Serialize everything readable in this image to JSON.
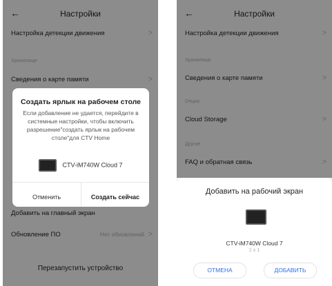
{
  "left": {
    "header": {
      "back": "←",
      "title": "Настройки"
    },
    "rows": {
      "motion": "Настройка детекции движения",
      "storage_section": "Хранилище",
      "sdcard": "Сведения о карте памяти",
      "add_home": "Добавить на главный экран",
      "update": "Обновление ПО",
      "update_value": "Нет обновлений",
      "restart": "Перезапустить устройство"
    },
    "dialog": {
      "title": "Создать ярлык на рабочем столе",
      "body": "Если добавление не удается, перейдите в системные настройки, чтобы включить разрешение\"создать ярлык на рабочем столе\"для CTV Home",
      "device": "CTV-iM740W Cloud 7",
      "cancel": "Отменить",
      "create": "Создать сейчас"
    }
  },
  "right": {
    "header": {
      "back": "←",
      "title": "Настройки"
    },
    "rows": {
      "motion": "Настройка детекции движения",
      "storage_section": "Хранилище",
      "sdcard": "Сведения о карте памяти",
      "option_section": "Опция",
      "cloud": "Cloud Storage",
      "other_section": "Другие",
      "faq": "FAQ и обратная связь"
    },
    "sheet": {
      "title": "Добавить на рабочий экран",
      "device": "CTV-iM740W Cloud 7",
      "size": "1 x 1",
      "cancel": "ОТМЕНА",
      "add": "ДОБАВИТЬ"
    }
  },
  "chevron": ">"
}
